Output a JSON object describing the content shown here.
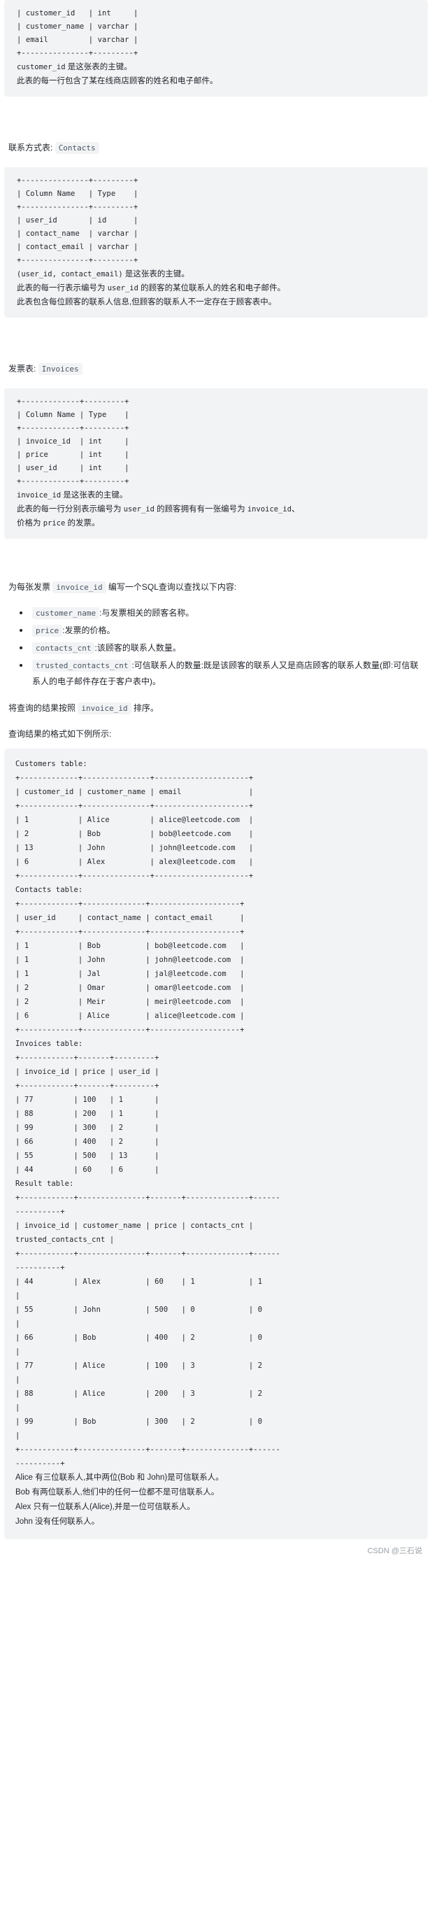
{
  "customers_block": {
    "lines": [
      "| customer_id   | int     |",
      "| customer_name | varchar |",
      "| email         | varchar |",
      "+---------------+---------+"
    ],
    "note_1_code": "customer_id",
    "note_1_text": " 是这张表的主键。",
    "note_2": "此表的每一行包含了某在线商店顾客的姓名和电子邮件。"
  },
  "contacts_section": {
    "title_label": "联系方式表:",
    "title_code": "Contacts",
    "lines": [
      "+---------------+---------+",
      "| Column Name   | Type    |",
      "+---------------+---------+",
      "| user_id       | id      |",
      "| contact_name  | varchar |",
      "| contact_email | varchar |",
      "+---------------+---------+"
    ],
    "note_1_code": "(user_id, contact_email)",
    "note_1_text": " 是这张表的主键。",
    "note_2_a": "此表的每一行表示编号为 ",
    "note_2_code": "user_id",
    "note_2_b": " 的顾客的某位联系人的姓名和电子邮件。",
    "note_3": "此表包含每位顾客的联系人信息,但顾客的联系人不一定存在于顾客表中。"
  },
  "invoices_section": {
    "title_label": "发票表:",
    "title_code": "Invoices",
    "lines": [
      "+-------------+---------+",
      "| Column Name | Type    |",
      "+-------------+---------+",
      "| invoice_id  | int     |",
      "| price       | int     |",
      "| user_id     | int     |",
      "+-------------+---------+"
    ],
    "note_1_code": "invoice_id",
    "note_1_text": " 是这张表的主键。",
    "note_2_a": "此表的每一行分别表示编号为 ",
    "note_2_code_1": "user_id",
    "note_2_b": " 的顾客拥有有一张编号为 ",
    "note_2_code_2": "invoice_id",
    "note_2_c": "、",
    "note_3_a": "价格为 ",
    "note_3_code": "price",
    "note_3_b": " 的发票。"
  },
  "task": {
    "intro_a": "为每张发票 ",
    "intro_code": "invoice_id",
    "intro_b": " 编写一个SQL查询以查找以下内容:",
    "bullets": [
      {
        "code": "customer_name",
        "text": ":与发票相关的顾客名称。"
      },
      {
        "code": "price",
        "text": ":发票的价格。"
      },
      {
        "code": "contacts_cnt",
        "text": ":该顾客的联系人数量。"
      },
      {
        "code": "trusted_contacts_cnt",
        "text": ":可信联系人的数量:既是该顾客的联系人又是商店顾客的联系人数量(即:可信联系人的电子邮件存在于客户表中)。"
      }
    ],
    "order_a": "将查询的结果按照 ",
    "order_code": "invoice_id",
    "order_b": " 排序。",
    "format_note": "查询结果的格式如下例所示:"
  },
  "example_block": {
    "customers_title": "Customers table:",
    "customers_lines": [
      "+-------------+---------------+---------------------+",
      "| customer_id | customer_name | email               |",
      "+-------------+---------------+---------------------+",
      "| 1           | Alice         | alice@leetcode.com  |",
      "| 2           | Bob           | bob@leetcode.com    |",
      "| 13          | John          | john@leetcode.com   |",
      "| 6           | Alex          | alex@leetcode.com   |",
      "+-------------+---------------+---------------------+"
    ],
    "contacts_title": "Contacts table:",
    "contacts_lines": [
      "+-------------+--------------+--------------------+",
      "| user_id     | contact_name | contact_email      |",
      "+-------------+--------------+--------------------+",
      "| 1           | Bob          | bob@leetcode.com   |",
      "| 1           | John         | john@leetcode.com  |",
      "| 1           | Jal          | jal@leetcode.com   |",
      "| 2           | Omar         | omar@leetcode.com  |",
      "| 2           | Meir         | meir@leetcode.com  |",
      "| 6           | Alice        | alice@leetcode.com |",
      "+-------------+--------------+--------------------+"
    ],
    "invoices_title": "Invoices table:",
    "invoices_lines": [
      "+------------+-------+---------+",
      "| invoice_id | price | user_id |",
      "+------------+-------+---------+",
      "| 77         | 100   | 1       |",
      "| 88         | 200   | 1       |",
      "| 99         | 300   | 2       |",
      "| 66         | 400   | 2       |",
      "| 55         | 500   | 13      |",
      "| 44         | 60    | 6       |",
      "+------------+-------+---------+"
    ],
    "result_title": "Result table:",
    "result_lines": [
      "+------------+---------------+-------+--------------+------",
      "----------+",
      "| invoice_id | customer_name | price | contacts_cnt |",
      "trusted_contacts_cnt |",
      "+------------+---------------+-------+--------------+------",
      "----------+",
      "| 44         | Alex          | 60    | 1            | 1",
      "|",
      "| 55         | John          | 500   | 0            | 0",
      "|",
      "| 66         | Bob           | 400   | 2            | 0",
      "|",
      "| 77         | Alice         | 100   | 3            | 2",
      "|",
      "| 88         | Alice         | 200   | 3            | 2",
      "|",
      "| 99         | Bob           | 300   | 2            | 0",
      "|",
      "+------------+---------------+-------+--------------+------",
      "----------+"
    ],
    "explanations": [
      "Alice 有三位联系人,其中两位(Bob 和 John)是可信联系人。",
      "Bob 有两位联系人,他们中的任何一位都不是可信联系人。",
      "Alex 只有一位联系人(Alice),并是一位可信联系人。",
      "John 没有任何联系人。"
    ]
  },
  "watermark": "CSDN @三石说"
}
